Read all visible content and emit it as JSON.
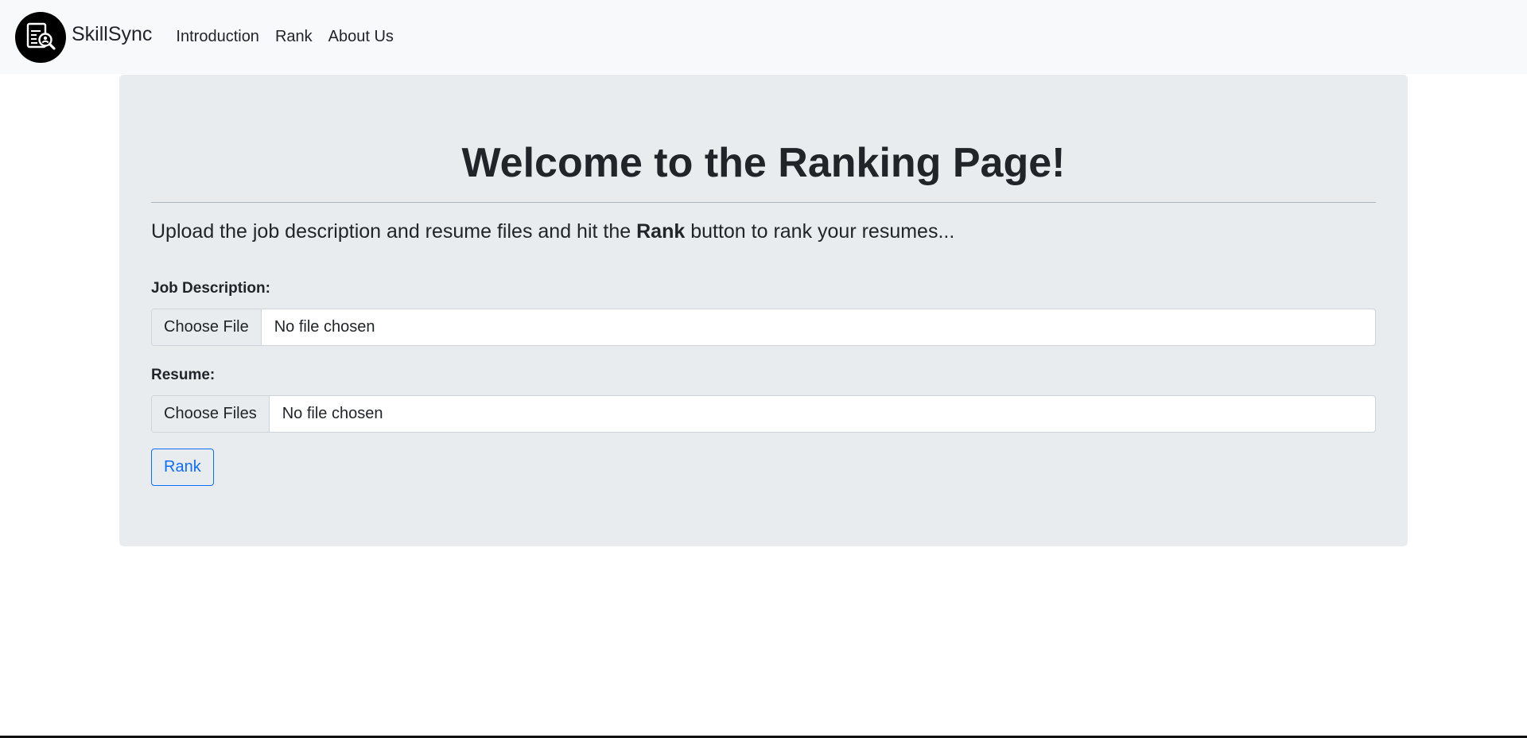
{
  "navbar": {
    "brand": "SkillSync",
    "links": [
      "Introduction",
      "Rank",
      "About Us"
    ]
  },
  "main": {
    "title": "Welcome to the Ranking Page!",
    "lead_before": "Upload the job description and resume files and hit the ",
    "lead_bold": "Rank",
    "lead_after": " button to rank your resumes...",
    "job_label": "Job Description:",
    "job_button": "Choose File",
    "job_status": "No file chosen",
    "resume_label": "Resume:",
    "resume_button": "Choose Files",
    "resume_status": "No file chosen",
    "rank_button": "Rank"
  },
  "colors": {
    "navbar_bg": "#f8f9fa",
    "panel_bg": "#e9ecef",
    "accent": "#0d6efd",
    "text": "#212529"
  },
  "icons": {
    "logo": "document-search-icon"
  }
}
